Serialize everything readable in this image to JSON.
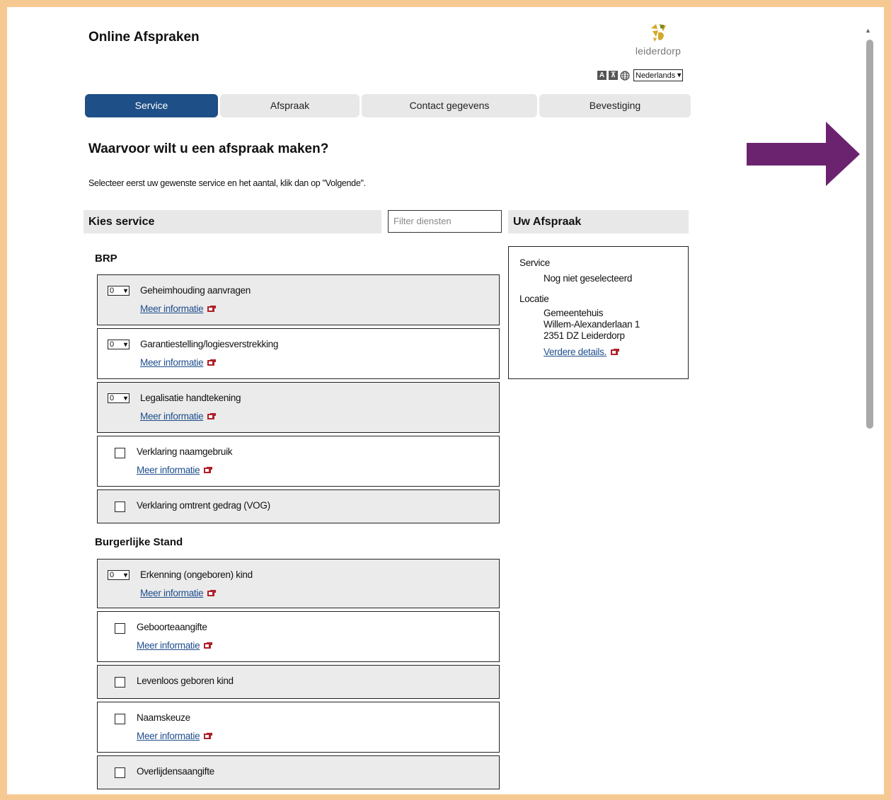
{
  "header": {
    "title": "Online Afspraken",
    "logo_text": "leiderdorp",
    "language": "Nederlands"
  },
  "tabs": [
    {
      "label": "Service"
    },
    {
      "label": "Afspraak"
    },
    {
      "label": "Contact gegevens"
    },
    {
      "label": "Bevestiging"
    }
  ],
  "main": {
    "question": "Waarvoor wilt u een afspraak maken?",
    "instruction": "Selecteer eerst uw gewenste service en het aantal, klik dan op \"Volgende\".",
    "kies_header": "Kies service",
    "filter_placeholder": "Filter diensten",
    "more_info": "Meer informatie"
  },
  "categories": [
    {
      "name": "BRP",
      "services": [
        {
          "name": "Geheimhouding aanvragen",
          "control": "quantity",
          "value": "0",
          "more": true
        },
        {
          "name": "Garantiestelling/logiesverstrekking",
          "control": "quantity",
          "value": "0",
          "more": true
        },
        {
          "name": "Legalisatie handtekening",
          "control": "quantity",
          "value": "0",
          "more": true
        },
        {
          "name": "Verklaring naamgebruik",
          "control": "checkbox",
          "more": true
        },
        {
          "name": "Verklaring omtrent gedrag (VOG)",
          "control": "checkbox",
          "more": false
        }
      ]
    },
    {
      "name": "Burgerlijke Stand",
      "services": [
        {
          "name": "Erkenning (ongeboren) kind",
          "control": "quantity",
          "value": "0",
          "more": true
        },
        {
          "name": "Geboorteaangifte",
          "control": "checkbox",
          "more": true
        },
        {
          "name": "Levenloos geboren kind",
          "control": "checkbox",
          "more": false
        },
        {
          "name": "Naamskeuze",
          "control": "checkbox",
          "more": true
        },
        {
          "name": "Overlijdensaangifte",
          "control": "checkbox",
          "more": false
        }
      ]
    }
  ],
  "appointment": {
    "header": "Uw Afspraak",
    "service_label": "Service",
    "service_value": "Nog niet geselecteerd",
    "location_label": "Locatie",
    "location_lines": [
      "Gemeentehuis",
      "Willem-Alexanderlaan 1",
      "2351 DZ Leiderdorp"
    ],
    "details_link": "Verdere details."
  },
  "colors": {
    "active_tab": "#1e4f86",
    "border": "#f7c992",
    "arrow": "#6b2370",
    "link": "#1f4e8c"
  }
}
